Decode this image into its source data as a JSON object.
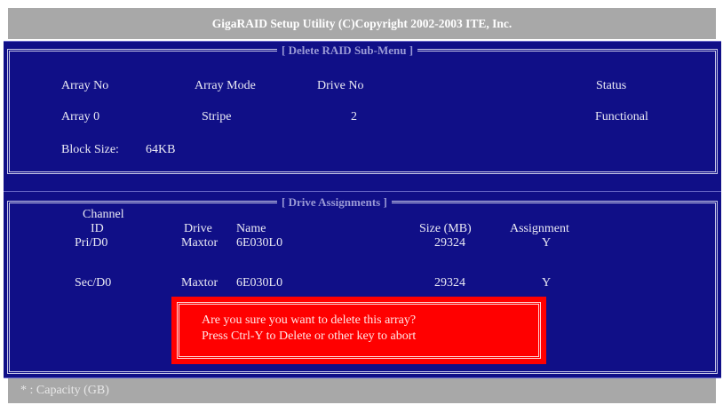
{
  "app_title": "GigaRAID Setup Utility (C)Copyright 2002-2003 ITE, Inc.",
  "delete_menu": {
    "heading": "[ Delete RAID Sub-Menu ]",
    "headers": {
      "array_no": "Array No",
      "array_mode": "Array Mode",
      "drive_no": "Drive No",
      "status": "Status"
    },
    "row": {
      "array_no": "Array 0",
      "array_mode": "Stripe",
      "drive_no": "2",
      "status": "Functional"
    },
    "block_size_label": "Block Size:",
    "block_size_value": "64KB"
  },
  "drive_assignments": {
    "heading": "[ Drive Assignments ]",
    "headers": {
      "channel": "Channel",
      "id": "ID",
      "drive": "Drive",
      "name": "Name",
      "size": "Size (MB)",
      "assignment": "Assignment"
    },
    "rows": [
      {
        "channel_id": "Pri/D0",
        "drive": "Maxtor",
        "name": "6E030L0",
        "size": "29324",
        "assignment": "Y"
      },
      {
        "channel_id": "Sec/D0",
        "drive": "Maxtor",
        "name": "6E030L0",
        "size": "29324",
        "assignment": "Y"
      }
    ]
  },
  "confirm_dialog": {
    "line1": "Are you sure you want to delete this array?",
    "line2": "Press Ctrl-Y to Delete or other key to abort"
  },
  "footer": {
    "note": "* : Capacity (GB)"
  },
  "colors": {
    "background": "#100f87",
    "title_bar": "#a8a8a8",
    "dialog": "#ff0000",
    "text": "#ffffff"
  }
}
